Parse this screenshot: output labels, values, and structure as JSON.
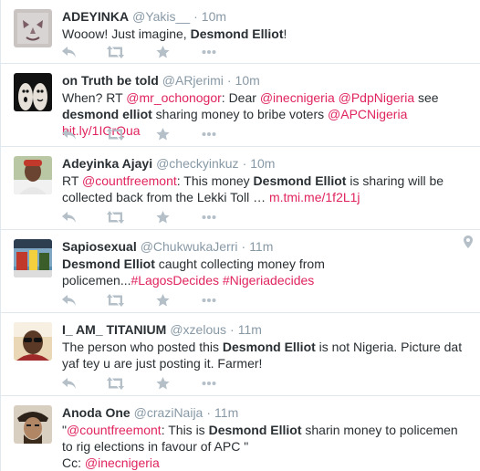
{
  "tweets": [
    {
      "fullname": "ADEYINKA",
      "username": "@Yakis__",
      "sep": "·",
      "time": "10m",
      "segments": [
        {
          "t": "Wooow! Just imagine, ",
          "k": "plain"
        },
        {
          "t": "Desmond Elliot",
          "k": "bold"
        },
        {
          "t": "!",
          "k": "plain"
        }
      ]
    },
    {
      "fullname": "on Truth be told",
      "username": "@ARjerimi",
      "sep": "·",
      "time": "10m",
      "segments": [
        {
          "t": "When? RT ",
          "k": "plain"
        },
        {
          "t": "@mr_ochonogor",
          "k": "link"
        },
        {
          "t": ": Dear ",
          "k": "plain"
        },
        {
          "t": "@inecnigeria",
          "k": "link"
        },
        {
          "t": " ",
          "k": "plain"
        },
        {
          "t": "@PdpNigeria",
          "k": "link"
        },
        {
          "t": "  see ",
          "k": "plain"
        },
        {
          "t": "desmond elliot",
          "k": "bold"
        },
        {
          "t": " sharing money to bribe voters ",
          "k": "plain"
        },
        {
          "t": "@APCNigeria",
          "k": "link"
        },
        {
          "t": "  ",
          "k": "plain"
        },
        {
          "t": "bit.ly/1ICrQua",
          "k": "link"
        }
      ]
    },
    {
      "fullname": "Adeyinka Ajayi",
      "username": "@checkyinkuz",
      "sep": "·",
      "time": "10m",
      "segments": [
        {
          "t": "RT ",
          "k": "plain"
        },
        {
          "t": "@countfreemont",
          "k": "link"
        },
        {
          "t": ": This money ",
          "k": "plain"
        },
        {
          "t": "Desmond Elliot",
          "k": "bold"
        },
        {
          "t": " is sharing will be collected back from the Lekki Toll … ",
          "k": "plain"
        },
        {
          "t": "m.tmi.me/1f2L1j",
          "k": "link"
        }
      ]
    },
    {
      "fullname": "Sapiosexual",
      "username": "@ChukwukaJerri",
      "sep": "·",
      "time": "11m",
      "segments": [
        {
          "t": "Desmond Elliot",
          "k": "bold"
        },
        {
          "t": " caught collecting money from policemen...",
          "k": "plain"
        },
        {
          "t": "#LagosDecides",
          "k": "link"
        },
        {
          "t": " ",
          "k": "plain"
        },
        {
          "t": "#Nigeriadecides",
          "k": "link"
        }
      ]
    },
    {
      "fullname": "I_ AM_ TITANIUM",
      "username": "@xzelous",
      "sep": "·",
      "time": "11m",
      "segments": [
        {
          "t": "The person who posted this ",
          "k": "plain"
        },
        {
          "t": "Desmond Elliot",
          "k": "bold"
        },
        {
          "t": " is not Nigeria. Picture dat yaf tey u are just posting it. Farmer!",
          "k": "plain"
        }
      ]
    },
    {
      "fullname": "Anoda One",
      "username": "@craziNaija",
      "sep": "·",
      "time": "11m",
      "segments": [
        {
          "t": "\"",
          "k": "plain"
        },
        {
          "t": "@countfreemont",
          "k": "link"
        },
        {
          "t": ": This is ",
          "k": "plain"
        },
        {
          "t": "Desmond Elliot",
          "k": "bold"
        },
        {
          "t": " sharin money to policemen to rig elections in favour of APC \"",
          "k": "plain"
        },
        {
          "t": "\n",
          "k": "br"
        },
        {
          "t": "Cc: ",
          "k": "plain"
        },
        {
          "t": "@inecnigeria",
          "k": "link"
        }
      ]
    }
  ],
  "icons": {
    "reply": "reply-icon",
    "retweet": "retweet-icon",
    "favorite": "favorite-icon",
    "more": "more-icon",
    "geo": "location-pin-icon"
  },
  "colors": {
    "link": "#e0245e",
    "meta": "#8899a6",
    "action": "#b4bfc8",
    "divider": "#e1e8ed"
  }
}
